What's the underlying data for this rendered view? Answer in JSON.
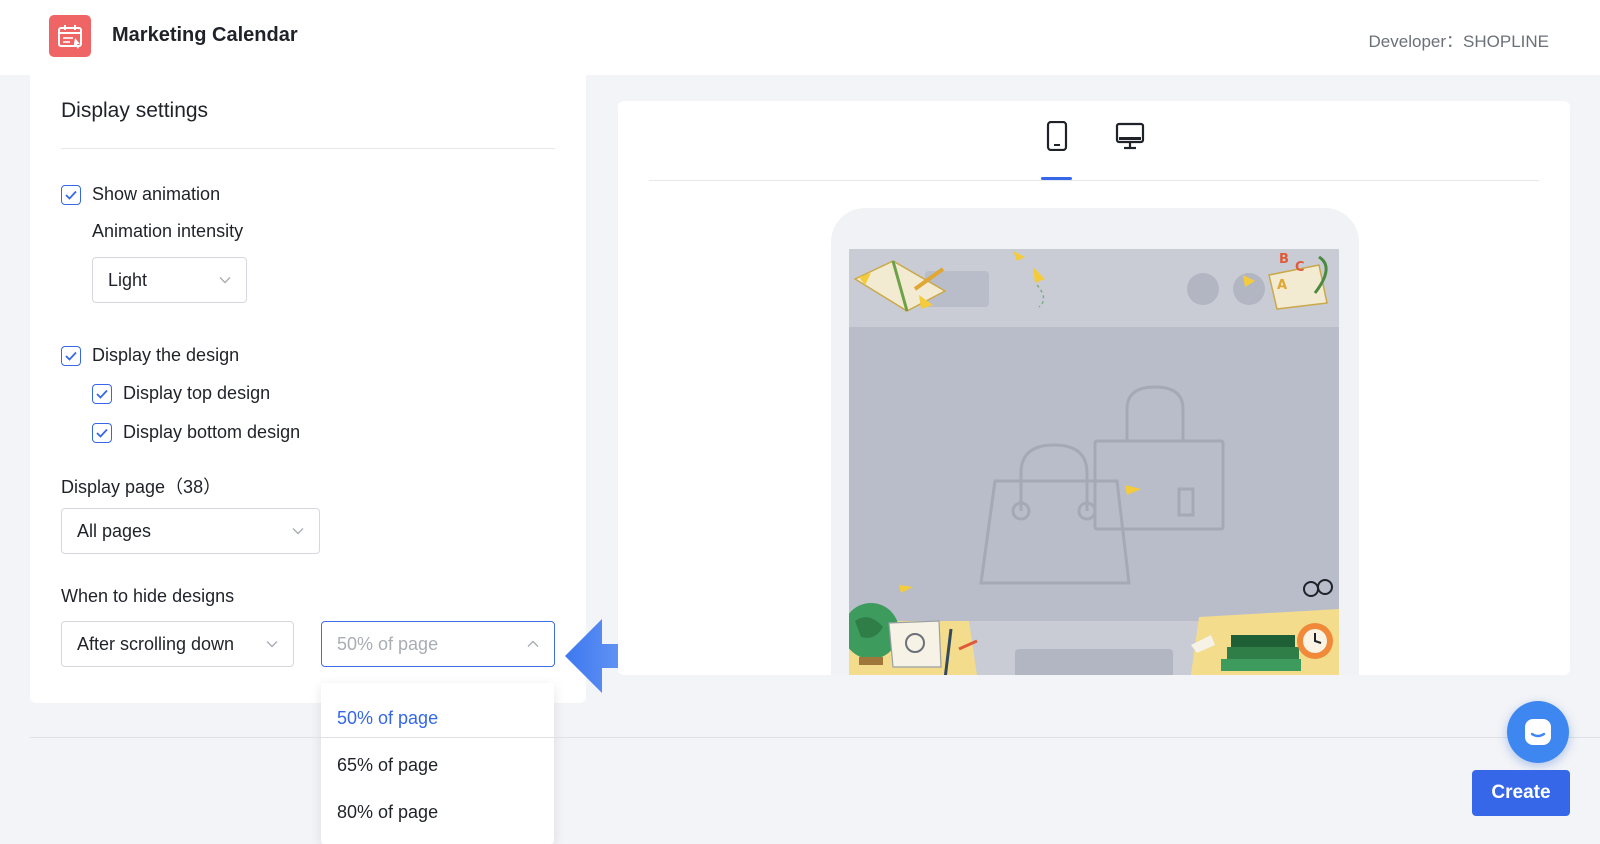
{
  "header": {
    "app_title": "Marketing Calendar",
    "developer": "Developer：SHOPLINE",
    "logo_icon": "calendar-icon"
  },
  "settings": {
    "title": "Display settings",
    "show_animation": {
      "label": "Show animation",
      "checked": true
    },
    "animation_intensity": {
      "label": "Animation intensity",
      "value": "Light"
    },
    "display_design": {
      "label": "Display the design",
      "checked": true
    },
    "display_top": {
      "label": "Display top design",
      "checked": true
    },
    "display_bottom": {
      "label": "Display bottom design",
      "checked": true
    },
    "display_page": {
      "label": "Display page（38）",
      "value": "All pages"
    },
    "hide_designs": {
      "label": "When to hide designs",
      "trigger_value": "After scrolling down",
      "amount_placeholder": "50% of page",
      "options": [
        "50% of page",
        "65% of page",
        "80% of page"
      ],
      "selected_option": "50% of page"
    }
  },
  "preview": {
    "tabs": [
      "mobile-icon",
      "desktop-icon"
    ],
    "active_tab": "mobile-icon"
  },
  "footer": {
    "create_label": "Create",
    "chat_icon": "chat-icon"
  },
  "colors": {
    "accent": "#3567e8",
    "logo": "#ef6464",
    "chat": "#3f87f0"
  }
}
